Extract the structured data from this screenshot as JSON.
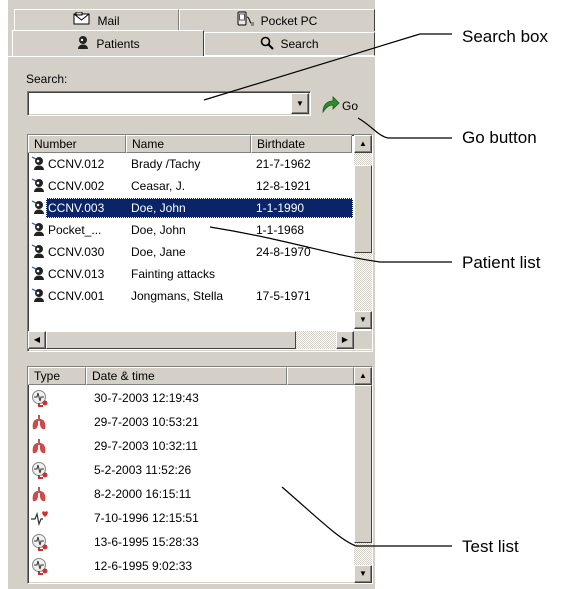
{
  "tabs": {
    "back": [
      {
        "label": "Mail",
        "icon": "mail-icon"
      },
      {
        "label": "Pocket PC",
        "icon": "pocket-pc-icon"
      }
    ],
    "front": [
      {
        "label": "Patients",
        "icon": "patients-icon",
        "active": true
      },
      {
        "label": "Search",
        "icon": "search-icon",
        "active": false
      }
    ]
  },
  "search": {
    "label": "Search:",
    "value": "",
    "go_label": "Go"
  },
  "patient_list": {
    "columns": [
      "Number",
      "Name",
      "Birthdate"
    ],
    "rows": [
      {
        "number": "CCNV.012",
        "name": "Brady /Tachy",
        "birthdate": "21-7-1962",
        "selected": false
      },
      {
        "number": "CCNV.002",
        "name": "Ceasar, J.",
        "birthdate": "12-8-1921",
        "selected": false
      },
      {
        "number": "CCNV.003",
        "name": "Doe, John",
        "birthdate": "1-1-1990",
        "selected": true
      },
      {
        "number": "Pocket_...",
        "name": "Doe, John",
        "birthdate": "1-1-1968",
        "selected": false
      },
      {
        "number": "CCNV.030",
        "name": "Doe, Jane",
        "birthdate": "24-8-1970",
        "selected": false
      },
      {
        "number": "CCNV.013",
        "name": "Fainting attacks",
        "birthdate": "",
        "selected": false
      },
      {
        "number": "CCNV.001",
        "name": "Jongmans, Stella",
        "birthdate": "17-5-1971",
        "selected": false
      }
    ]
  },
  "test_list": {
    "columns": [
      "Type",
      "Date & time"
    ],
    "rows": [
      {
        "type": "holter-test-icon",
        "datetime": "30-7-2003 12:19:43"
      },
      {
        "type": "spirometry-icon",
        "datetime": "29-7-2003 10:53:21"
      },
      {
        "type": "spirometry-icon",
        "datetime": "29-7-2003 10:32:11"
      },
      {
        "type": "holter-test-icon",
        "datetime": "5-2-2003 11:52:26"
      },
      {
        "type": "spirometry-icon",
        "datetime": "8-2-2000 16:15:11"
      },
      {
        "type": "ecg-icon",
        "datetime": "7-10-1996 12:15:51"
      },
      {
        "type": "holter-test-icon",
        "datetime": "13-6-1995 15:28:33"
      },
      {
        "type": "holter-test-icon",
        "datetime": "12-6-1995 9:02:33"
      }
    ]
  },
  "callouts": {
    "search_box": "Search box",
    "go_button": "Go button",
    "patient_list": "Patient list",
    "test_list": "Test list"
  },
  "colors": {
    "panel": "#d4d0c8",
    "selection": "#0a246a",
    "go_arrow": "#2e8b2e",
    "test_red": "#c83232"
  }
}
